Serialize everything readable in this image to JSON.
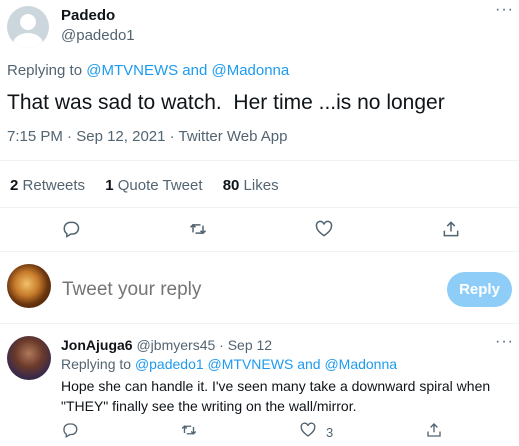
{
  "tweet": {
    "author_name": "Padedo",
    "author_handle": "@padedo1",
    "more_label": "···",
    "replying_prefix": "Replying to",
    "replying_users": "@MTVNEWS and @Madonna",
    "text": "That was sad to watch.  Her time ...is no longer",
    "time": "7:15 PM",
    "date": "Sep 12, 2021",
    "source": "Twitter Web App",
    "dot": "·",
    "stats": {
      "retweets_count": "2",
      "retweets_label": "Retweets",
      "quotes_count": "1",
      "quotes_label": "Quote Tweet",
      "likes_count": "80",
      "likes_label": "Likes"
    }
  },
  "compose": {
    "placeholder": "Tweet your reply",
    "reply_button": "Reply"
  },
  "reply": {
    "author_name": "JonAjuga6",
    "author_handle": "@jbmyers45",
    "dot": "·",
    "date": "Sep 12",
    "more_label": "···",
    "replying_prefix": "Replying to",
    "replying_users": "@padedo1 @MTVNEWS and @Madonna",
    "text": "Hope she can handle it. I've seen many take a downward spiral when \"THEY\" finally see the writing on the wall/mirror.",
    "likes_count": "3"
  },
  "colors": {
    "accent": "#1d9bf0",
    "muted": "#536471",
    "reply_button_bg": "#8ecdf8"
  },
  "icons": [
    "reply-icon",
    "retweet-icon",
    "like-icon",
    "share-icon",
    "more-icon"
  ]
}
